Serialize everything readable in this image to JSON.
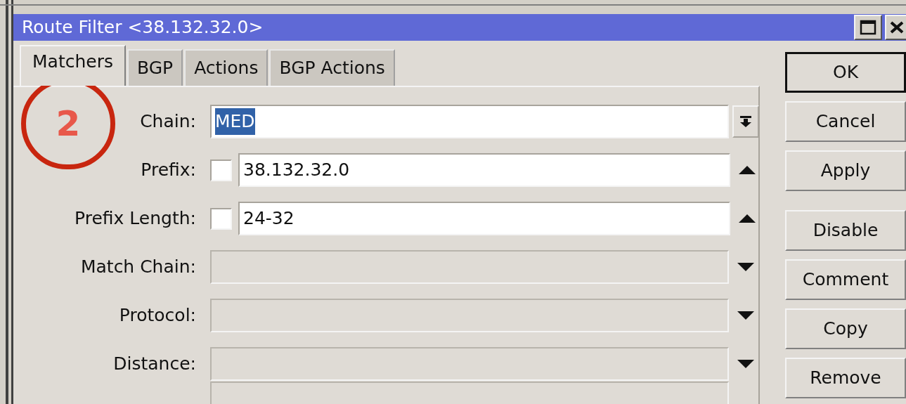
{
  "window": {
    "title": "Route Filter <38.132.32.0>"
  },
  "tabs": [
    {
      "label": "Matchers",
      "selected": true
    },
    {
      "label": "BGP",
      "selected": false
    },
    {
      "label": "Actions",
      "selected": false
    },
    {
      "label": "BGP Actions",
      "selected": false
    }
  ],
  "fields": [
    {
      "kind": "combo",
      "label": "Chain:",
      "value": "MED",
      "selected": true
    },
    {
      "kind": "checked_text",
      "label": "Prefix:",
      "checked": false,
      "value": "38.132.32.0"
    },
    {
      "kind": "checked_text",
      "label": "Prefix Length:",
      "checked": false,
      "value": "24-32"
    },
    {
      "kind": "dropdown",
      "label": "Match Chain:"
    },
    {
      "kind": "dropdown",
      "label": "Protocol:"
    },
    {
      "kind": "dropdown",
      "label": "Distance:"
    },
    {
      "kind": "partial"
    }
  ],
  "buttons": [
    {
      "label": "OK",
      "default": true
    },
    {
      "label": "Cancel",
      "default": false
    },
    {
      "label": "Apply",
      "default": false
    },
    {
      "label": "Disable",
      "default": false
    },
    {
      "label": "Comment",
      "default": false
    },
    {
      "label": "Copy",
      "default": false
    },
    {
      "label": "Remove",
      "default": false
    }
  ],
  "annotation": {
    "label": "2"
  }
}
